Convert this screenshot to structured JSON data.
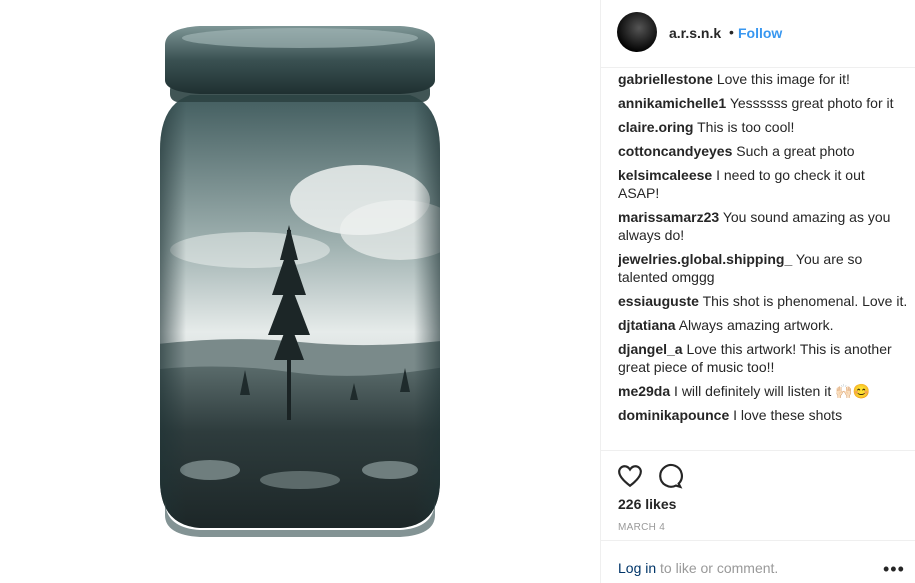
{
  "post": {
    "username": "a.r.s.n.k",
    "separator": "•",
    "follow_label": "Follow"
  },
  "comments": [
    {
      "user": "gabriellestone",
      "text": "Love this image for it!"
    },
    {
      "user": "annikamichelle1",
      "text": "Yessssss great photo for it"
    },
    {
      "user": "claire.oring",
      "text": "This is too cool!"
    },
    {
      "user": "cottoncandyeyes",
      "text": "Such a great photo"
    },
    {
      "user": "kelsimcaleese",
      "text": "I need to go check it out ASAP!"
    },
    {
      "user": "marissamarz23",
      "text": "You sound amazing as you always do!"
    },
    {
      "user": "jewelries.global.shipping_",
      "text": "You are so talented omggg"
    },
    {
      "user": "essiauguste",
      "text": "This shot is phenomenal. Love it."
    },
    {
      "user": "djtatiana",
      "text": "Always amazing artwork."
    },
    {
      "user": "djangel_a",
      "text": "Love this artwork! This is another great piece of music too!!"
    },
    {
      "user": "me29da",
      "text": "I will definitely will listen it 🙌🏻😊"
    },
    {
      "user": "dominikapounce",
      "text": "I love these shots"
    }
  ],
  "actions": {
    "like_icon": "heart-icon",
    "comment_icon": "comment-icon"
  },
  "likes": "226 likes",
  "date": "MARCH 4",
  "login": {
    "link": "Log in",
    "text": " to like or comment.",
    "more": "•••"
  }
}
